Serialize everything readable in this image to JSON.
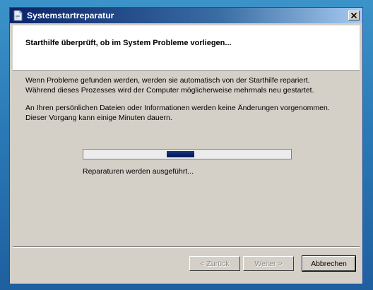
{
  "window": {
    "title": "Systemstartreparatur",
    "close_symbol": "✕",
    "app_icon": "document-icon"
  },
  "header": {
    "title": "Starthilfe überprüft, ob im System Probleme vorliegen..."
  },
  "content": {
    "paragraph1_line1": "Wenn Probleme gefunden werden, werden sie automatisch von der Starthilfe repariert.",
    "paragraph1_line2": "Während dieses Prozesses wird der Computer möglicherweise mehrmals neu gestartet.",
    "paragraph2_line1": "An Ihren persönlichen Dateien oder Informationen werden keine Änderungen vorgenommen.",
    "paragraph2_line2": "Dieser Vorgang kann einige Minuten dauern."
  },
  "progress": {
    "style": "marquee",
    "status_text": "Reparaturen werden ausgeführt..."
  },
  "buttons": {
    "back": "< Zurück",
    "next": "Weiter >",
    "cancel": "Abbrechen"
  },
  "colors": {
    "titlebar_start": "#0a246a",
    "titlebar_end": "#a6caf0",
    "dialog_face": "#d4d0c8",
    "progress_chunk": "#0a246a",
    "desktop": "#2a79b6"
  }
}
